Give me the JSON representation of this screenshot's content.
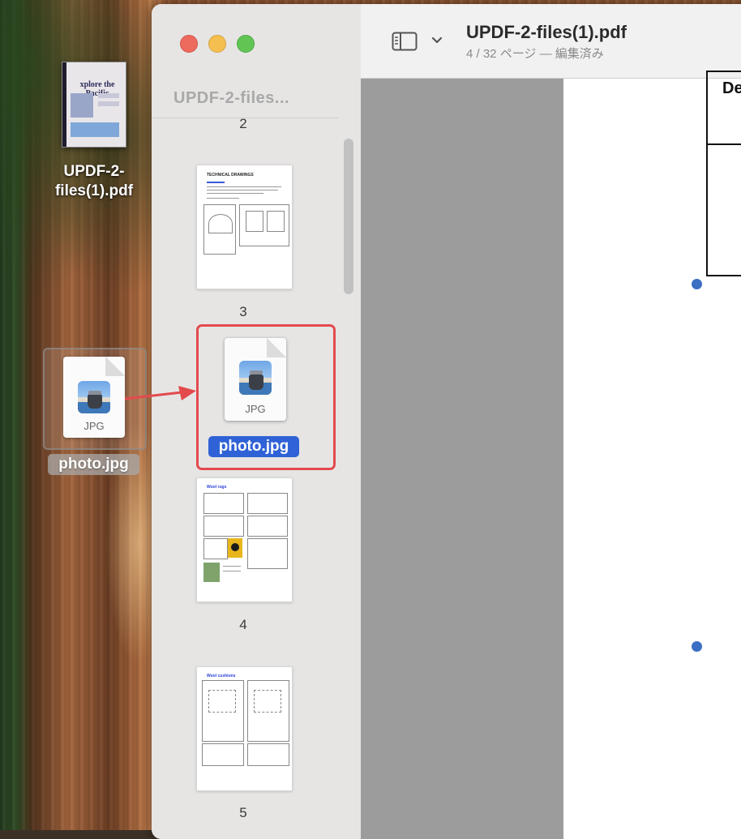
{
  "desktop": {
    "pdf_file": {
      "name": "UPDF-2-\nfiles(1).pdf",
      "line1": "UPDF-2-",
      "line2": "files(1).pdf",
      "thumb_title": "xplore the Pacific"
    },
    "jpg_file": {
      "name": "photo.jpg",
      "ext": "JPG"
    }
  },
  "window": {
    "sidebar": {
      "title": "UPDF-2-files...",
      "pages": [
        {
          "label": "2"
        },
        {
          "label": "3",
          "heading": "TECHNICAL DRAWINGS"
        },
        {
          "label": "4",
          "heading": "Wool rugs"
        },
        {
          "label": "5",
          "heading": "Wool cushions"
        }
      ],
      "inserted_file": {
        "name": "photo.jpg",
        "ext": "JPG"
      }
    },
    "toolbar": {
      "document_title": "UPDF-2-files(1).pdf",
      "status": "4 / 32 ページ — 編集済み",
      "sidebar_toggle_icon": "sidebar-icon",
      "chevron_icon": "chevron-down-icon"
    },
    "content": {
      "page_heading": "De"
    }
  },
  "colors": {
    "selection_blue": "#2f62d6",
    "highlight_red": "#e34a4e",
    "close": "#ed6a5e",
    "minimize": "#f5bf4f",
    "zoom": "#61c554"
  }
}
